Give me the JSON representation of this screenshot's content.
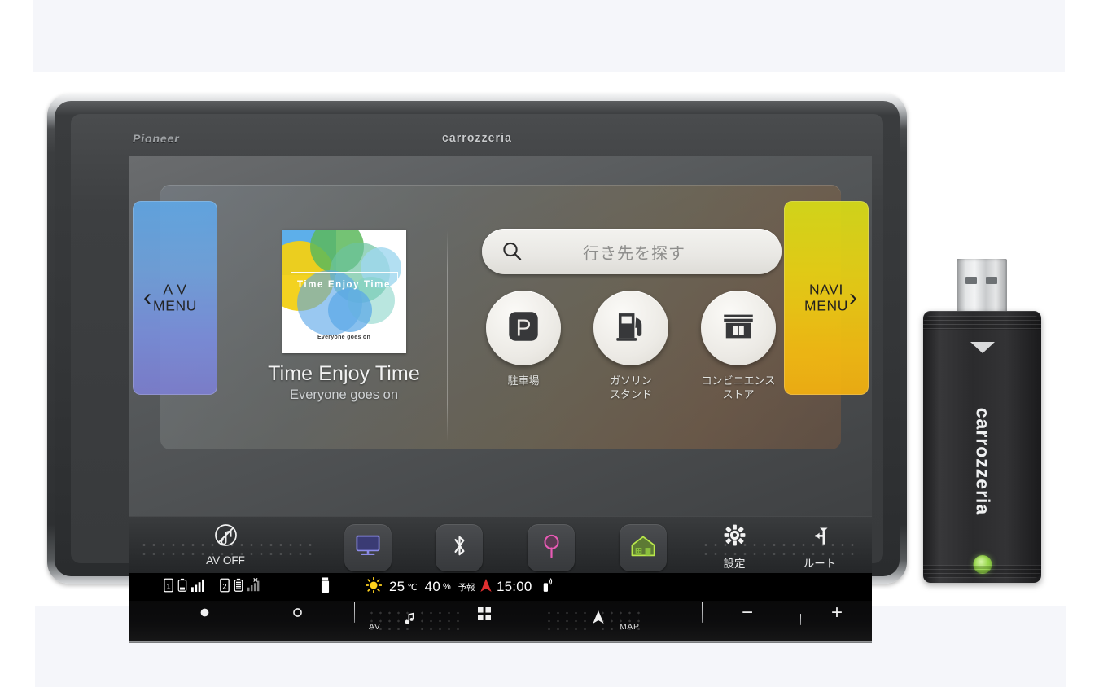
{
  "device": {
    "brand_left": "Pioneer",
    "brand_center": "carrozzeria"
  },
  "now_playing": {
    "album_title": "Time Enjoy Time",
    "album_caption": "Everyone goes on",
    "track_title": "Time Enjoy Time",
    "artist": "Everyone goes on"
  },
  "search": {
    "placeholder": "行き先を探す",
    "icon": "search-icon"
  },
  "poi": [
    {
      "label": "駐車場",
      "icon": "parking-icon"
    },
    {
      "label": "ガソリン\nスタンド",
      "label_line1": "ガソリン",
      "label_line2": "スタンド",
      "icon": "fuel-pump-icon"
    },
    {
      "label": "コンビニエンス\nストア",
      "label_line1": "コンビニエンス",
      "label_line2": "ストア",
      "icon": "convenience-store-icon"
    }
  ],
  "side_menus": {
    "left": {
      "line1": "A V",
      "line2": "MENU",
      "chevron": "‹",
      "color": "#6fa3e0"
    },
    "right": {
      "line1": "NAVI",
      "line2": "MENU",
      "chevron": "›",
      "color": "#ebd312"
    }
  },
  "toolbar": {
    "av_off_label": "AV OFF",
    "av_off_icon": "music-note-muted-icon",
    "display_icon": "monitor-icon",
    "bluetooth_icon": "bluetooth-icon",
    "pin_icon": "map-pin-icon",
    "home_icon": "home-icon",
    "settings_label": "設定",
    "settings_icon": "gear-icon",
    "route_label": "ルート",
    "route_icon": "route-fork-icon"
  },
  "statusbar": {
    "phone1_badge": "1",
    "phone2_badge": "2",
    "temperature": "25",
    "temperature_unit": "℃",
    "humidity": "40",
    "humidity_unit": "%",
    "forecast_label": "予報",
    "clock": "15:00",
    "icons": [
      "phone1-icon",
      "battery-low-icon",
      "signal-bars-icon",
      "phone2-icon",
      "battery-full-icon",
      "signal-none-icon",
      "usb-icon",
      "sun-icon",
      "gps-arrow-icon",
      "antenna-icon"
    ]
  },
  "hardkeys": {
    "av_label": "AV",
    "av_icon": "music-note-icon",
    "map_label": "MAP",
    "map_icon": "nav-arrow-icon",
    "apps_icon": "grid-apps-icon",
    "volume_down": "−",
    "volume_up": "+",
    "power_icon": "power-dot-icon",
    "ring_icon": "ring-button-icon"
  },
  "dongle": {
    "brand": "carrozzeria",
    "marker_icon": "triangle-marker-icon",
    "led_icon": "status-led-icon",
    "led_color": "#9ad94e"
  }
}
